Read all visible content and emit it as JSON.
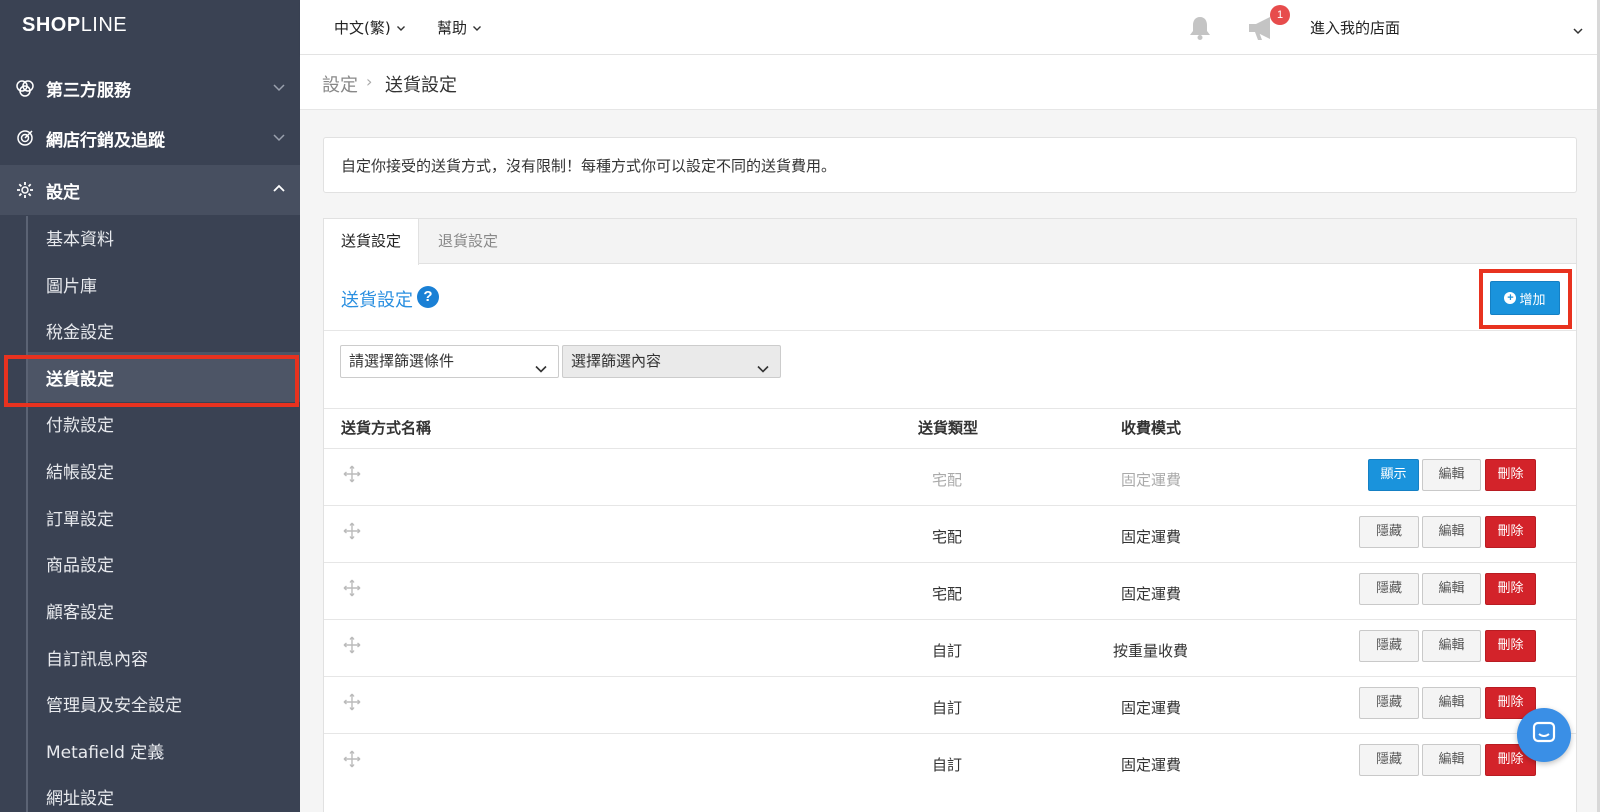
{
  "brand": {
    "logo_bold": "SHOP",
    "logo_rest": "LINE"
  },
  "sidebar": {
    "groups": [
      {
        "label": "第三方服務",
        "icon": "circles-icon"
      },
      {
        "label": "網店行銷及追蹤",
        "icon": "target-icon"
      },
      {
        "label": "設定",
        "icon": "gear-icon"
      }
    ],
    "sub_items": [
      "基本資料",
      "圖片庫",
      "稅金設定",
      "送貨設定",
      "付款設定",
      "結帳設定",
      "訂單設定",
      "商品設定",
      "顧客設定",
      "自訂訊息內容",
      "管理員及安全設定",
      "Metafield 定義",
      "網址設定"
    ],
    "active_sub_item": "送貨設定"
  },
  "topbar": {
    "language": "中文(繁)",
    "help": "幫助",
    "notification_count": "1",
    "store_link": "進入我的店面"
  },
  "breadcrumb": {
    "root": "設定",
    "separator": "›",
    "current": "送貨設定"
  },
  "info_text": "自定你接受的送貨方式，沒有限制！每種方式你可以設定不同的送貨費用。",
  "tabs": [
    {
      "label": "送貨設定",
      "active": true
    },
    {
      "label": "退貨設定",
      "active": false
    }
  ],
  "section": {
    "title": "送貨設定",
    "help_icon": "?",
    "add_button": "增加"
  },
  "filters": {
    "condition_placeholder": "請選擇篩選條件",
    "content_placeholder": "選擇篩選內容"
  },
  "table": {
    "headers": {
      "name": "送貨方式名稱",
      "type": "送貨類型",
      "fee_mode": "收費模式"
    },
    "rows": [
      {
        "name": "",
        "type": "宅配",
        "fee_mode": "固定運費",
        "visibility_button": "顯示",
        "hidden": true
      },
      {
        "name": "",
        "type": "宅配",
        "fee_mode": "固定運費",
        "visibility_button": "隱藏",
        "hidden": false
      },
      {
        "name": "",
        "type": "宅配",
        "fee_mode": "固定運費",
        "visibility_button": "隱藏",
        "hidden": false
      },
      {
        "name": "",
        "type": "自訂",
        "fee_mode": "按重量收費",
        "visibility_button": "隱藏",
        "hidden": false
      },
      {
        "name": "",
        "type": "自訂",
        "fee_mode": "固定運費",
        "visibility_button": "隱藏",
        "hidden": false
      },
      {
        "name": "",
        "type": "自訂",
        "fee_mode": "固定運費",
        "visibility_button": "隱藏",
        "hidden": false
      }
    ],
    "edit_label": "編輯",
    "delete_label": "刪除"
  },
  "colors": {
    "sidebar_bg": "#3a4253",
    "primary_blue": "#1a93dc",
    "danger_red": "#d3232a",
    "highlight_red": "#e8321f",
    "title_blue": "#2a8fe0"
  }
}
